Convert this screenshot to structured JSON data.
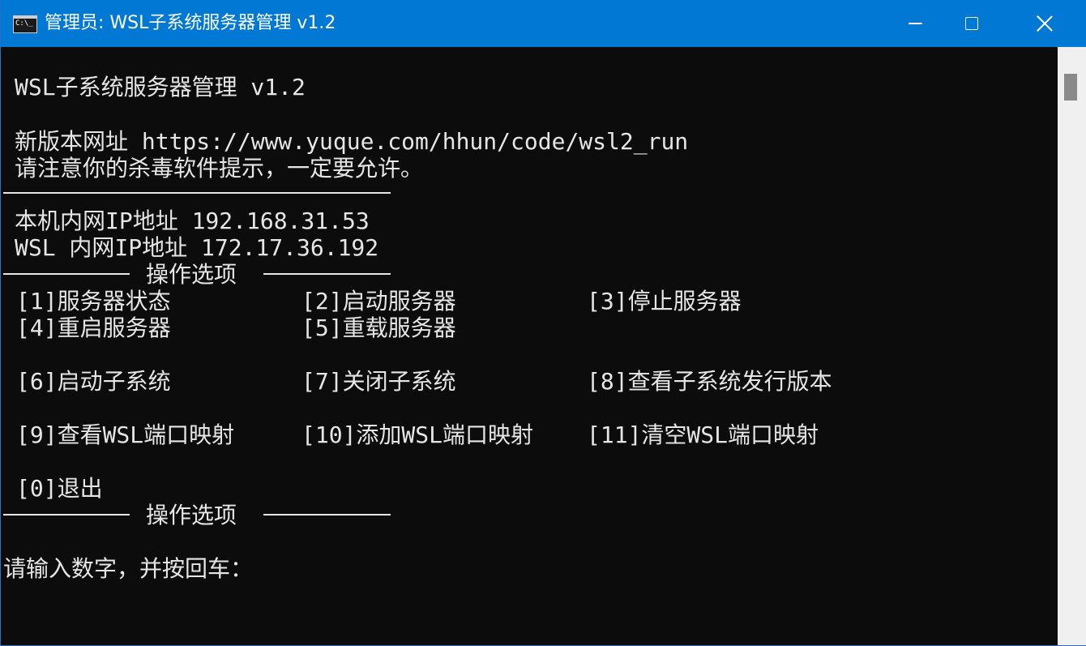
{
  "window": {
    "title": "管理员: WSL子系统服务器管理 v1.2",
    "icon": "cmd-icon",
    "icon_text": "C:\\_",
    "controls": [
      "minimize",
      "maximize",
      "close"
    ]
  },
  "console": {
    "header": "WSL子系统服务器管理 v1.2",
    "url_line": "新版本网址 https://www.yuque.com/hhun/code/wsl2_run",
    "warning": "请注意你的杀毒软件提示，一定要允许。",
    "local_ip": "本机内网IP地址 192.168.31.53",
    "wsl_ip": "WSL 内网IP地址 172.17.36.192",
    "section_title": "操作选项",
    "options": {
      "o1": "[1]服务器状态",
      "o2": "[2]启动服务器",
      "o3": "[3]停止服务器",
      "o4": "[4]重启服务器",
      "o5": "[5]重载服务器",
      "o6": "[6]启动子系统",
      "o7": "[7]关闭子系统",
      "o8": "[8]查看子系统发行版本",
      "o9": "[9]查看WSL端口映射",
      "o10": "[10]添加WSL端口映射",
      "o11": "[11]清空WSL端口映射",
      "o0": "[0]退出"
    },
    "prompt": "请输入数字，并按回车："
  },
  "colors": {
    "titlebar": "#0078d4",
    "console_bg": "#0c0c0c",
    "console_fg": "#e6e6e6",
    "scrollbar": "#f0f0f0"
  }
}
